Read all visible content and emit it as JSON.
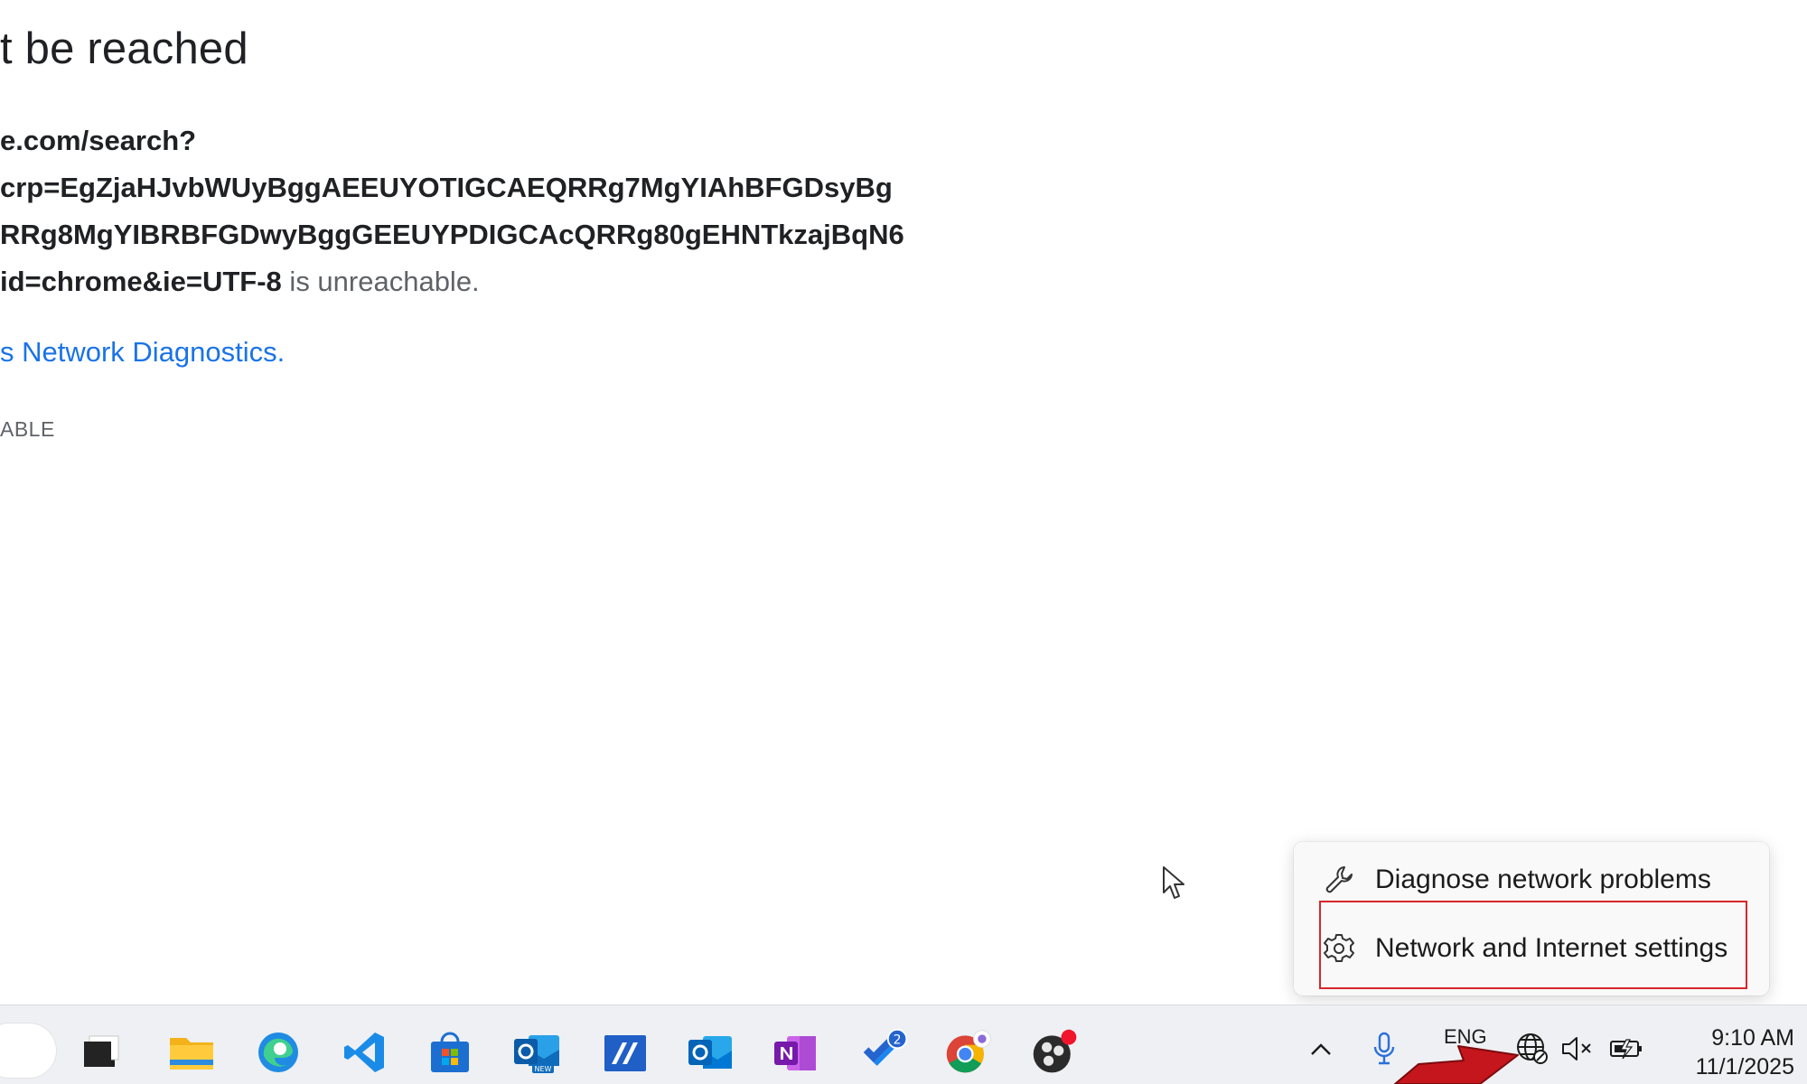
{
  "error": {
    "title": "t be reached",
    "url_line1": "e.com/search?",
    "url_line2": "crp=EgZjaHJvbWUyBggAEEUYOTIGCAEQRRg7MgYIAhBFGDsyBg",
    "url_line3": "RRg8MgYIBRBFGDwyBggGEEUYPDIGCAcQRRg80gEHNTkzajBqN6",
    "url_line4_strong": "id=chrome&ie=UTF-8",
    "url_line4_suffix": " is unreachable.",
    "diagnostics_link": "s Network Diagnostics.",
    "error_code": "ABLE"
  },
  "context_menu": {
    "items": [
      {
        "label": "Diagnose network problems",
        "icon": "wrench-icon"
      },
      {
        "label": "Network and Internet settings",
        "icon": "gear-icon"
      }
    ],
    "highlight_color": "#d7262b"
  },
  "taskbar": {
    "apps": [
      {
        "name": "task-view",
        "icon": "task-view-icon"
      },
      {
        "name": "file-explorer",
        "icon": "folder-icon"
      },
      {
        "name": "edge",
        "icon": "edge-icon"
      },
      {
        "name": "vscode",
        "icon": "vscode-icon"
      },
      {
        "name": "microsoft-store",
        "icon": "store-icon"
      },
      {
        "name": "outlook-new",
        "icon": "outlook-new-icon",
        "badge": "NEW"
      },
      {
        "name": "app-slash",
        "icon": "slash-app-icon"
      },
      {
        "name": "outlook",
        "icon": "outlook-icon"
      },
      {
        "name": "onenote",
        "icon": "onenote-icon"
      },
      {
        "name": "todo",
        "icon": "todo-icon",
        "badge_count": "2"
      },
      {
        "name": "chrome",
        "icon": "chrome-icon"
      },
      {
        "name": "obs",
        "icon": "obs-icon"
      }
    ],
    "tray": {
      "language": "ENG",
      "time": "9:10 AM",
      "date": "11/1/2025"
    }
  },
  "colors": {
    "link": "#1a73e8",
    "taskbar_bg": "#eef0f3",
    "arrow": "#c4161c"
  }
}
